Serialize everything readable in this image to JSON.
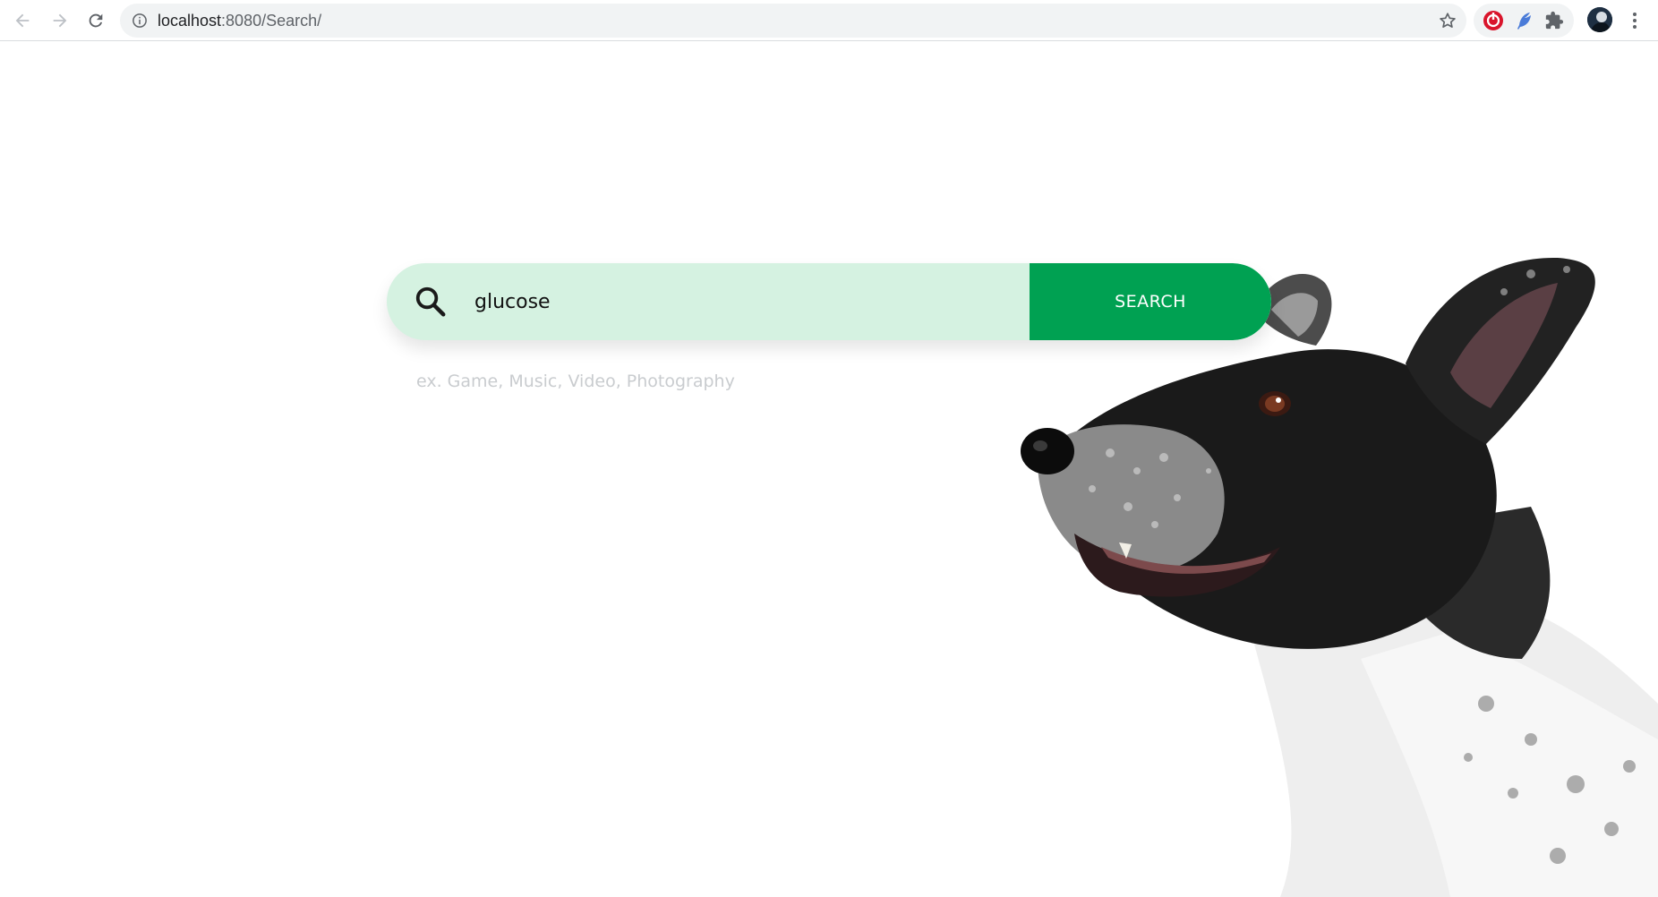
{
  "browser": {
    "url_host": "localhost",
    "url_path": ":8080/Search/",
    "icons": {
      "back": "arrow-left-icon",
      "forward": "arrow-right-icon",
      "reload": "reload-icon",
      "site_info": "info-icon",
      "bookmark": "star-icon",
      "extensions": [
        "red-extension-icon",
        "feather-extension-icon",
        "puzzle-icon"
      ],
      "profile": "avatar",
      "menu": "kebab-menu-icon"
    }
  },
  "search": {
    "value": "glucose",
    "button_label": "SEARCH",
    "hint": "ex. Game, Music, Video, Photography"
  },
  "colors": {
    "search_field_bg": "#d5f2e1",
    "search_button_bg": "#00a152",
    "hint_text": "#c9cccf"
  },
  "illustration": "black-and-white dog photo"
}
